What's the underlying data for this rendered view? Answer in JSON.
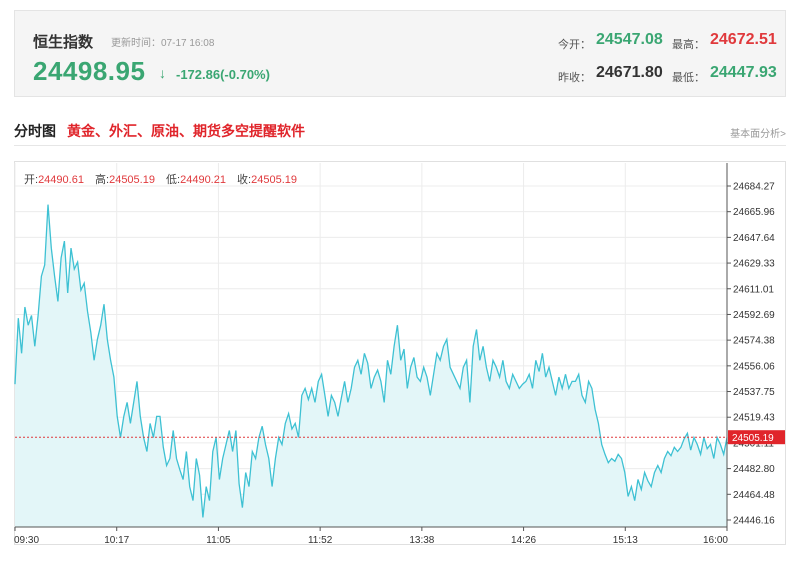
{
  "quote": {
    "name": "恒生指数",
    "update_time": "更新时间：07-17 16:08",
    "price": "24498.95",
    "arrow": "↓",
    "change": "-172.86(-0.70%)",
    "open_label": "今开：",
    "open_value": "24547.08",
    "high_label": "最高：",
    "high_value": "24672.51",
    "prev_close_label": "昨收：",
    "prev_close_value": "24671.80",
    "low_label": "最低：",
    "low_value": "24447.93",
    "colors": {
      "down": "#3aa672",
      "up": "#e0393c"
    }
  },
  "section": {
    "title": "分时图",
    "ad_link": "黄金、外汇、原油、期货多空提醒软件",
    "right_link": "基本面分析>"
  },
  "ohlc": {
    "open_label": "开:",
    "open_value": "24490.61",
    "high_label": "高:",
    "high_value": "24505.19",
    "low_label": "低:",
    "low_value": "24490.21",
    "close_label": "收:",
    "close_value": "24505.19"
  },
  "chart_data": {
    "type": "area",
    "colors": {
      "line": "#3ec1d3",
      "fill": "#e3f6f8",
      "last_price_line": "#e0393c",
      "last_price_tag": "#e0252b"
    },
    "x_ticks": [
      "09:30",
      "10:17",
      "11:05",
      "11:52",
      "13:38",
      "14:26",
      "15:13",
      "16:00"
    ],
    "y_ticks": [
      "24684.27",
      "24665.96",
      "24647.64",
      "24629.33",
      "24611.01",
      "24592.69",
      "24574.38",
      "24556.06",
      "24537.75",
      "24519.43",
      "24501.11",
      "24482.80",
      "24464.48",
      "24446.16"
    ],
    "ylim": [
      24446.16,
      24684.27
    ],
    "last_price": "24505.19",
    "grid": true,
    "points": [
      [
        0,
        24543
      ],
      [
        1,
        24590
      ],
      [
        2,
        24565
      ],
      [
        3,
        24598
      ],
      [
        4,
        24585
      ],
      [
        5,
        24592
      ],
      [
        6,
        24570
      ],
      [
        7,
        24592
      ],
      [
        8,
        24620
      ],
      [
        9,
        24628
      ],
      [
        10,
        24671
      ],
      [
        11,
        24640
      ],
      [
        12,
        24620
      ],
      [
        13,
        24602
      ],
      [
        14,
        24633
      ],
      [
        15,
        24645
      ],
      [
        16,
        24608
      ],
      [
        17,
        24640
      ],
      [
        18,
        24625
      ],
      [
        19,
        24630
      ],
      [
        20,
        24610
      ],
      [
        21,
        24615
      ],
      [
        22,
        24595
      ],
      [
        23,
        24580
      ],
      [
        24,
        24560
      ],
      [
        25,
        24575
      ],
      [
        26,
        24585
      ],
      [
        27,
        24600
      ],
      [
        28,
        24575
      ],
      [
        29,
        24560
      ],
      [
        30,
        24548
      ],
      [
        31,
        24520
      ],
      [
        32,
        24505
      ],
      [
        33,
        24520
      ],
      [
        34,
        24530
      ],
      [
        35,
        24515
      ],
      [
        36,
        24530
      ],
      [
        37,
        24545
      ],
      [
        38,
        24520
      ],
      [
        39,
        24505
      ],
      [
        40,
        24495
      ],
      [
        41,
        24515
      ],
      [
        42,
        24505
      ],
      [
        43,
        24520
      ],
      [
        44,
        24520
      ],
      [
        45,
        24498
      ],
      [
        46,
        24485
      ],
      [
        47,
        24490
      ],
      [
        48,
        24510
      ],
      [
        49,
        24490
      ],
      [
        50,
        24482
      ],
      [
        51,
        24475
      ],
      [
        52,
        24495
      ],
      [
        53,
        24470
      ],
      [
        54,
        24460
      ],
      [
        55,
        24490
      ],
      [
        56,
        24478
      ],
      [
        57,
        24448
      ],
      [
        58,
        24470
      ],
      [
        59,
        24460
      ],
      [
        60,
        24495
      ],
      [
        61,
        24505
      ],
      [
        62,
        24475
      ],
      [
        63,
        24490
      ],
      [
        64,
        24500
      ],
      [
        65,
        24510
      ],
      [
        66,
        24495
      ],
      [
        67,
        24510
      ],
      [
        68,
        24472
      ],
      [
        69,
        24455
      ],
      [
        70,
        24480
      ],
      [
        71,
        24470
      ],
      [
        72,
        24495
      ],
      [
        73,
        24490
      ],
      [
        74,
        24505
      ],
      [
        75,
        24513
      ],
      [
        76,
        24500
      ],
      [
        77,
        24490
      ],
      [
        78,
        24470
      ],
      [
        79,
        24490
      ],
      [
        80,
        24505
      ],
      [
        81,
        24500
      ],
      [
        82,
        24515
      ],
      [
        83,
        24522
      ],
      [
        84,
        24511
      ],
      [
        85,
        24515
      ],
      [
        86,
        24505
      ],
      [
        87,
        24535
      ],
      [
        88,
        24540
      ],
      [
        89,
        24532
      ],
      [
        90,
        24540
      ],
      [
        91,
        24530
      ],
      [
        92,
        24545
      ],
      [
        93,
        24550
      ],
      [
        94,
        24535
      ],
      [
        95,
        24520
      ],
      [
        96,
        24535
      ],
      [
        97,
        24530
      ],
      [
        98,
        24520
      ],
      [
        99,
        24533
      ],
      [
        100,
        24545
      ],
      [
        101,
        24530
      ],
      [
        102,
        24540
      ],
      [
        103,
        24555
      ],
      [
        104,
        24560
      ],
      [
        105,
        24550
      ],
      [
        106,
        24565
      ],
      [
        107,
        24558
      ],
      [
        108,
        24540
      ],
      [
        109,
        24548
      ],
      [
        110,
        24553
      ],
      [
        111,
        24545
      ],
      [
        112,
        24530
      ],
      [
        113,
        24560
      ],
      [
        114,
        24550
      ],
      [
        115,
        24570
      ],
      [
        116,
        24585
      ],
      [
        117,
        24560
      ],
      [
        118,
        24568
      ],
      [
        119,
        24540
      ],
      [
        120,
        24555
      ],
      [
        121,
        24562
      ],
      [
        122,
        24548
      ],
      [
        123,
        24545
      ],
      [
        124,
        24555
      ],
      [
        125,
        24548
      ],
      [
        126,
        24535
      ],
      [
        127,
        24550
      ],
      [
        128,
        24565
      ],
      [
        129,
        24560
      ],
      [
        130,
        24570
      ],
      [
        131,
        24575
      ],
      [
        132,
        24555
      ],
      [
        133,
        24550
      ],
      [
        134,
        24545
      ],
      [
        135,
        24540
      ],
      [
        136,
        24555
      ],
      [
        137,
        24560
      ],
      [
        138,
        24530
      ],
      [
        139,
        24570
      ],
      [
        140,
        24582
      ],
      [
        141,
        24560
      ],
      [
        142,
        24570
      ],
      [
        143,
        24555
      ],
      [
        144,
        24545
      ],
      [
        145,
        24560
      ],
      [
        146,
        24555
      ],
      [
        147,
        24548
      ],
      [
        148,
        24560
      ],
      [
        149,
        24545
      ],
      [
        150,
        24540
      ],
      [
        151,
        24550
      ],
      [
        152,
        24545
      ],
      [
        153,
        24540
      ],
      [
        154,
        24543
      ],
      [
        155,
        24545
      ],
      [
        156,
        24550
      ],
      [
        157,
        24540
      ],
      [
        158,
        24560
      ],
      [
        159,
        24552
      ],
      [
        160,
        24565
      ],
      [
        161,
        24548
      ],
      [
        162,
        24555
      ],
      [
        163,
        24545
      ],
      [
        164,
        24535
      ],
      [
        165,
        24548
      ],
      [
        166,
        24540
      ],
      [
        167,
        24550
      ],
      [
        168,
        24540
      ],
      [
        169,
        24545
      ],
      [
        170,
        24545
      ],
      [
        171,
        24550
      ],
      [
        172,
        24535
      ],
      [
        173,
        24530
      ],
      [
        174,
        24545
      ],
      [
        175,
        24540
      ],
      [
        176,
        24525
      ],
      [
        177,
        24515
      ],
      [
        178,
        24500
      ],
      [
        179,
        24493
      ],
      [
        180,
        24487
      ],
      [
        181,
        24490
      ],
      [
        182,
        24488
      ],
      [
        183,
        24493
      ],
      [
        184,
        24490
      ],
      [
        185,
        24480
      ],
      [
        186,
        24463
      ],
      [
        187,
        24470
      ],
      [
        188,
        24460
      ],
      [
        189,
        24475
      ],
      [
        190,
        24468
      ],
      [
        191,
        24480
      ],
      [
        192,
        24474
      ],
      [
        193,
        24470
      ],
      [
        194,
        24480
      ],
      [
        195,
        24485
      ],
      [
        196,
        24480
      ],
      [
        197,
        24490
      ],
      [
        198,
        24495
      ],
      [
        199,
        24492
      ],
      [
        200,
        24498
      ],
      [
        201,
        24495
      ],
      [
        202,
        24498
      ],
      [
        203,
        24504
      ],
      [
        204,
        24508
      ],
      [
        205,
        24496
      ],
      [
        206,
        24505
      ],
      [
        207,
        24500
      ],
      [
        208,
        24493
      ],
      [
        209,
        24505
      ],
      [
        210,
        24497
      ],
      [
        211,
        24500
      ],
      [
        212,
        24490
      ],
      [
        213,
        24505
      ],
      [
        214,
        24500
      ],
      [
        215,
        24493
      ],
      [
        216,
        24505
      ]
    ]
  }
}
